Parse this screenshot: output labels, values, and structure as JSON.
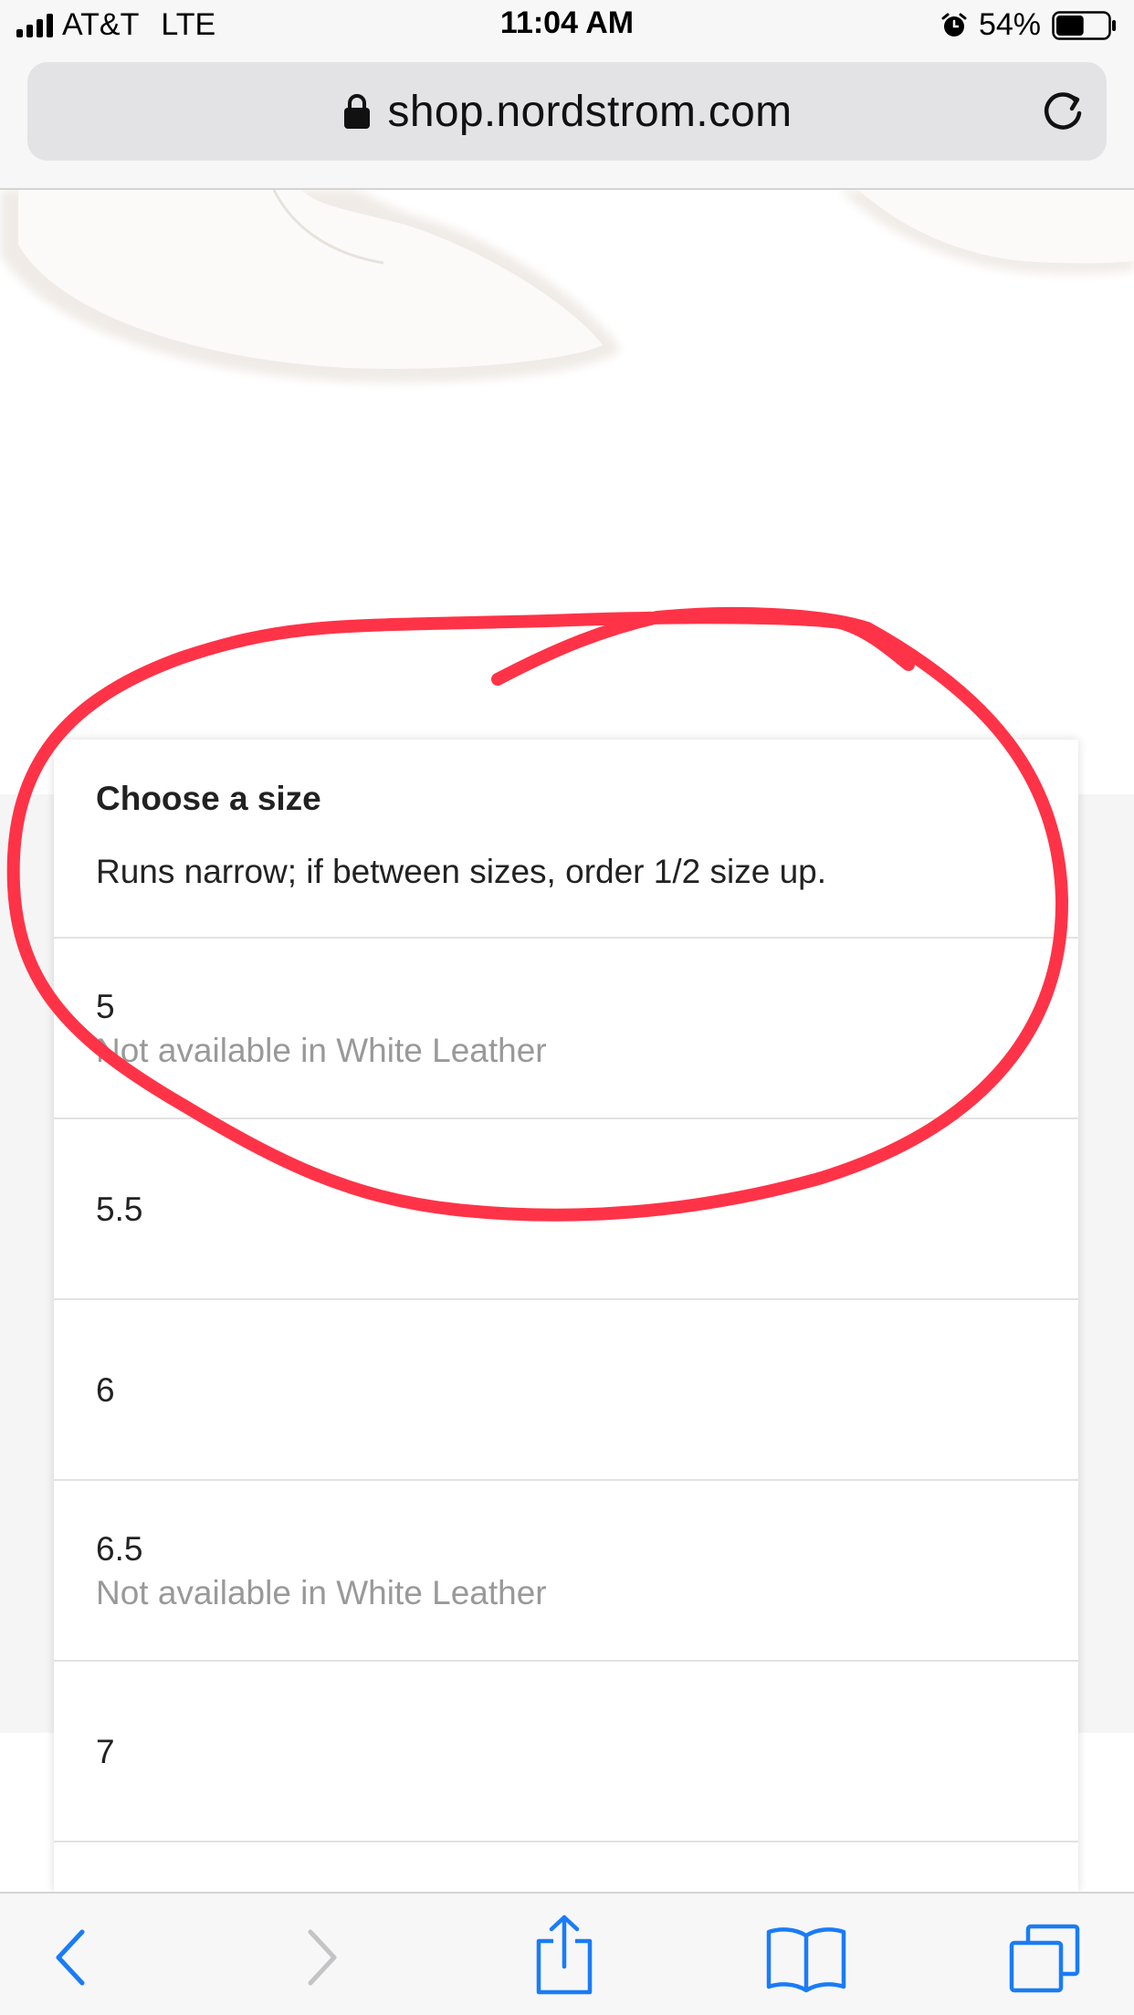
{
  "status_bar": {
    "carrier": "AT&T",
    "network": "LTE",
    "time": "11:04 AM",
    "battery_percent": "54%",
    "battery_level": 0.54,
    "icons": [
      "signal-icon",
      "alarm-icon",
      "battery-icon"
    ]
  },
  "browser": {
    "url": "shop.nordstrom.com",
    "icons": [
      "lock-icon",
      "reload-icon"
    ]
  },
  "size_picker": {
    "title": "Choose a size",
    "note": "Runs narrow; if between sizes, order 1/2 size up.",
    "options": [
      {
        "size": "5",
        "availability": "Not available in White Leather"
      },
      {
        "size": "5.5",
        "availability": ""
      },
      {
        "size": "6",
        "availability": ""
      },
      {
        "size": "6.5",
        "availability": "Not available in White Leather"
      },
      {
        "size": "7",
        "availability": ""
      }
    ]
  },
  "annotation": {
    "color": "#ff3347"
  },
  "toolbar": {
    "icons": [
      "back-icon",
      "forward-icon",
      "share-icon",
      "bookmarks-icon",
      "tabs-icon"
    ],
    "accent_color": "#1a7cf6",
    "disabled_color": "#c4c4c6"
  }
}
